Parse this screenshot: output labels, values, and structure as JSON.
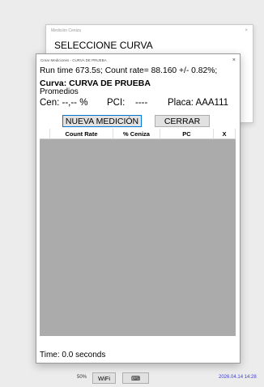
{
  "background_window": {
    "title": "Medición Ceniza",
    "close": "×",
    "heading": "SELECCIONE CURVA"
  },
  "window": {
    "title": "Crear Mediciones - CURVA DE PRUEBA",
    "close": "×",
    "run_line": "Run time 673.5s; Count rate= 88.160 +/- 0.82%;",
    "curva": "Curva: CURVA DE PRUEBA",
    "promedios": "Promedios",
    "cen": "Cen: --,-- %",
    "pci": "PCI:",
    "pci_value": "----",
    "placa": "Placa: AAA111",
    "btn_nueva": "NUEVA MEDICIÓN",
    "btn_cerrar": "CERRAR",
    "columns": [
      "",
      "Count Rate",
      "% Ceniza",
      "PC",
      "X"
    ],
    "time": "Time: 0.0 seconds"
  },
  "taskbar": {
    "zoom": "50%",
    "wifi": "WiFi",
    "keyboard": "⌨",
    "datetime": "2026.04.14  14:28"
  },
  "colors": {
    "accent": "#0078d7",
    "grid_bg": "#ababab",
    "datetime": "#3b3bd8"
  }
}
